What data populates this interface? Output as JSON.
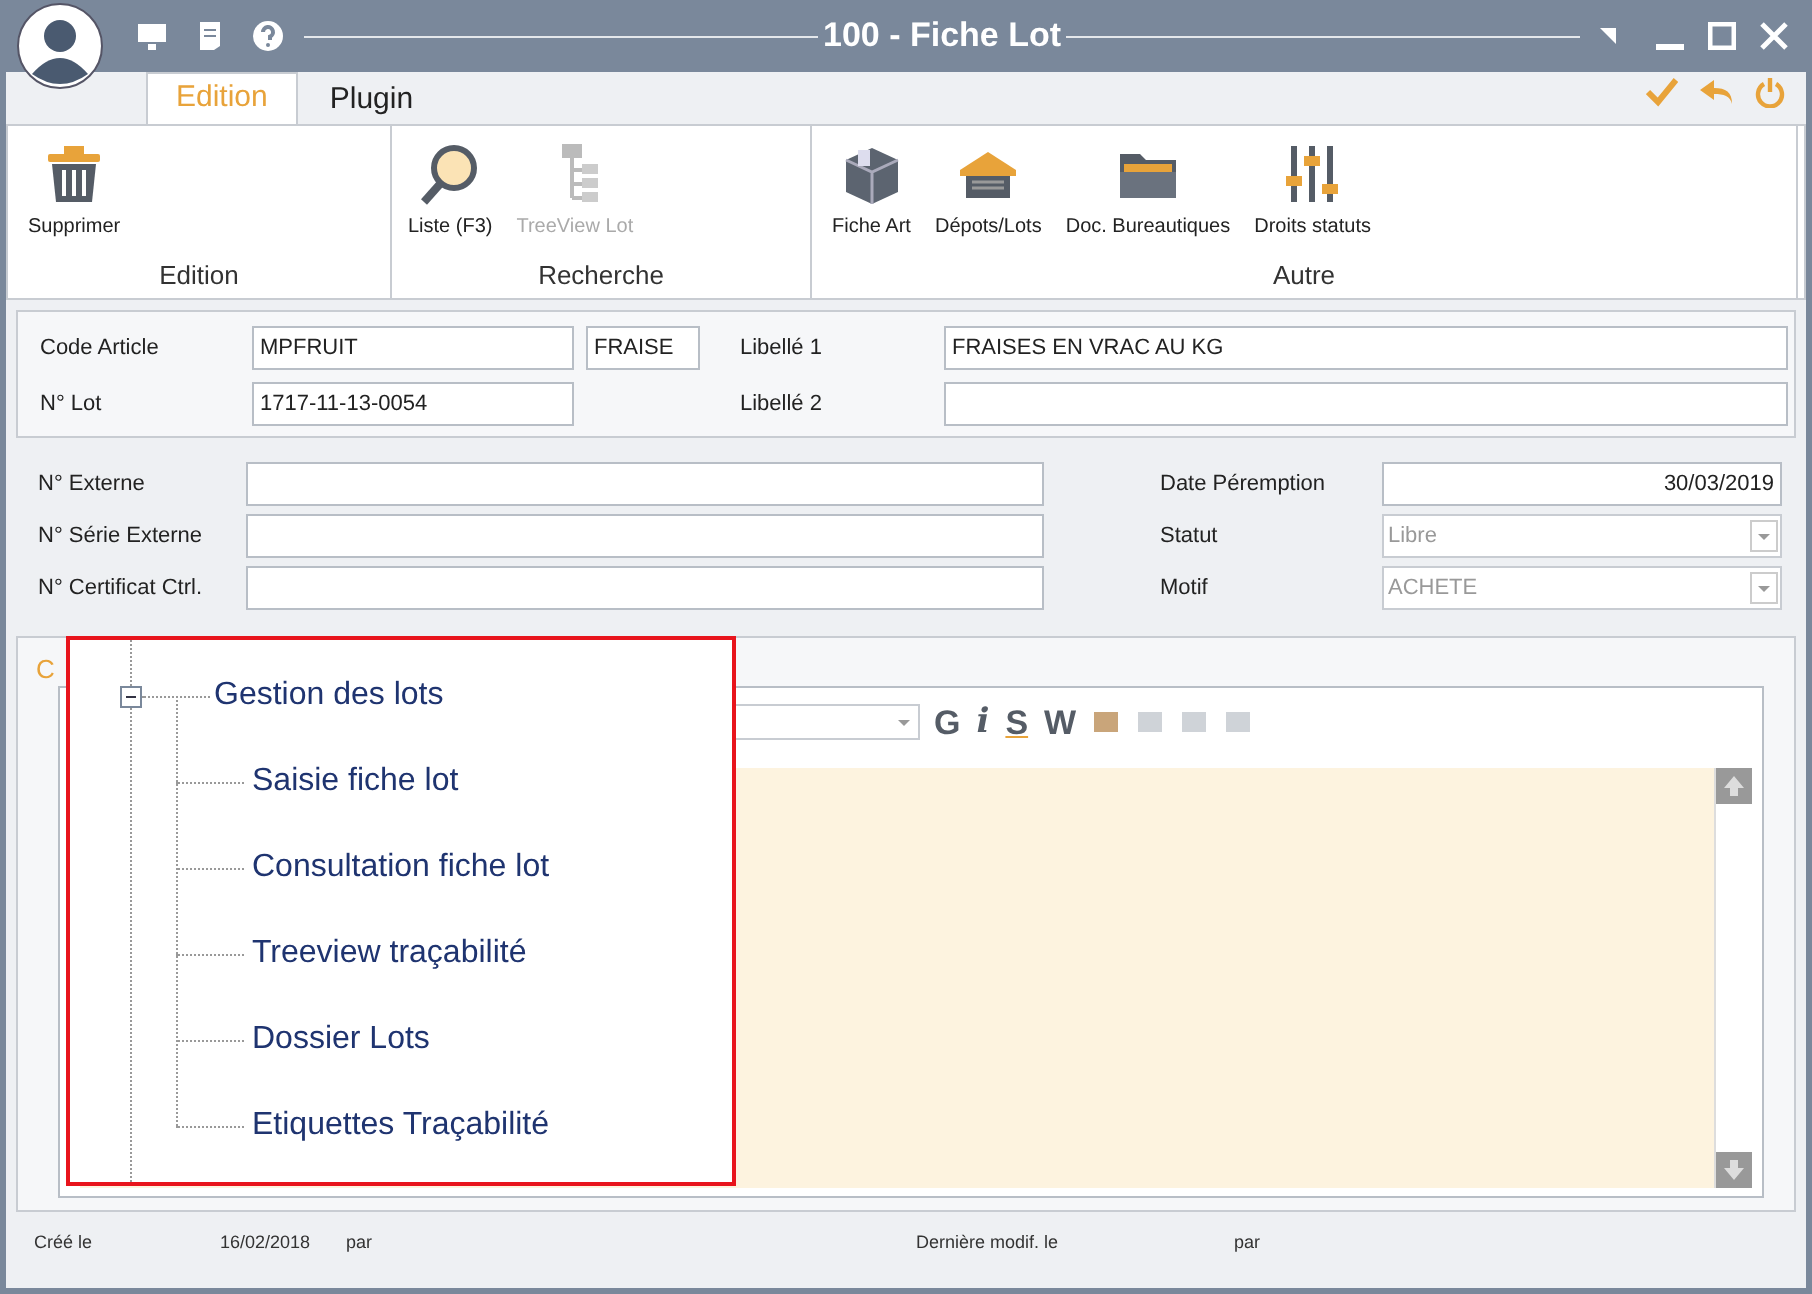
{
  "window": {
    "title": "100 - Fiche Lot"
  },
  "tabs": [
    {
      "label": "Edition",
      "selected": true
    },
    {
      "label": "Plugin",
      "selected": false
    }
  ],
  "ribbon": [
    {
      "label": "Edition",
      "items": [
        {
          "label": "Supprimer",
          "kind": "trash",
          "disabled": false
        }
      ]
    },
    {
      "label": "Recherche",
      "items": [
        {
          "label": "Liste (F3)",
          "kind": "magnifier",
          "disabled": false
        },
        {
          "label": "TreeView Lot",
          "kind": "tree",
          "disabled": true
        }
      ]
    },
    {
      "label": "Autre",
      "items": [
        {
          "label": "Fiche Art",
          "kind": "box",
          "disabled": false
        },
        {
          "label": "Dépots/Lots",
          "kind": "warehouse",
          "disabled": false
        },
        {
          "label": "Doc. Bureautiques",
          "kind": "folder",
          "disabled": false
        },
        {
          "label": "Droits statuts",
          "kind": "sliders",
          "disabled": false
        }
      ]
    }
  ],
  "article": {
    "code_label": "Code Article",
    "code": "MPFRUIT",
    "code_suffix": "FRAISE",
    "lot_label": "N° Lot",
    "lot": "1717-11-13-0054",
    "libelle1_label": "Libellé 1",
    "libelle1": "FRAISES EN VRAC AU KG",
    "libelle2_label": "Libellé 2"
  },
  "details": [
    {
      "label": "N° Externe",
      "right_label": "Date Péremption",
      "right_value": "30/03/2019",
      "kind": "date"
    },
    {
      "label": "N° Série Externe",
      "right_label": "Statut",
      "right_value": "Libre",
      "kind": "select"
    },
    {
      "label": "N° Certificat Ctrl.",
      "right_label": "Motif",
      "right_value": "ACHETE",
      "kind": "select"
    }
  ],
  "panel": {
    "tab_label": "C",
    "toolbar": [
      "G",
      "i",
      "S",
      "W"
    ]
  },
  "tree": {
    "label": "Gestion des lots",
    "expanded": true,
    "children": [
      {
        "label": "Saisie fiche lot"
      },
      {
        "label": "Consultation fiche lot"
      },
      {
        "label": "Treeview traçabilité"
      },
      {
        "label": "Dossier Lots"
      },
      {
        "label": "Etiquettes Traçabilité"
      }
    ]
  },
  "status_bar": {
    "created_label": "Créé le",
    "created": "16/02/2018",
    "created_by_label": "par",
    "modified_label": "Dernière modif. le",
    "modified_by_label": "par"
  }
}
